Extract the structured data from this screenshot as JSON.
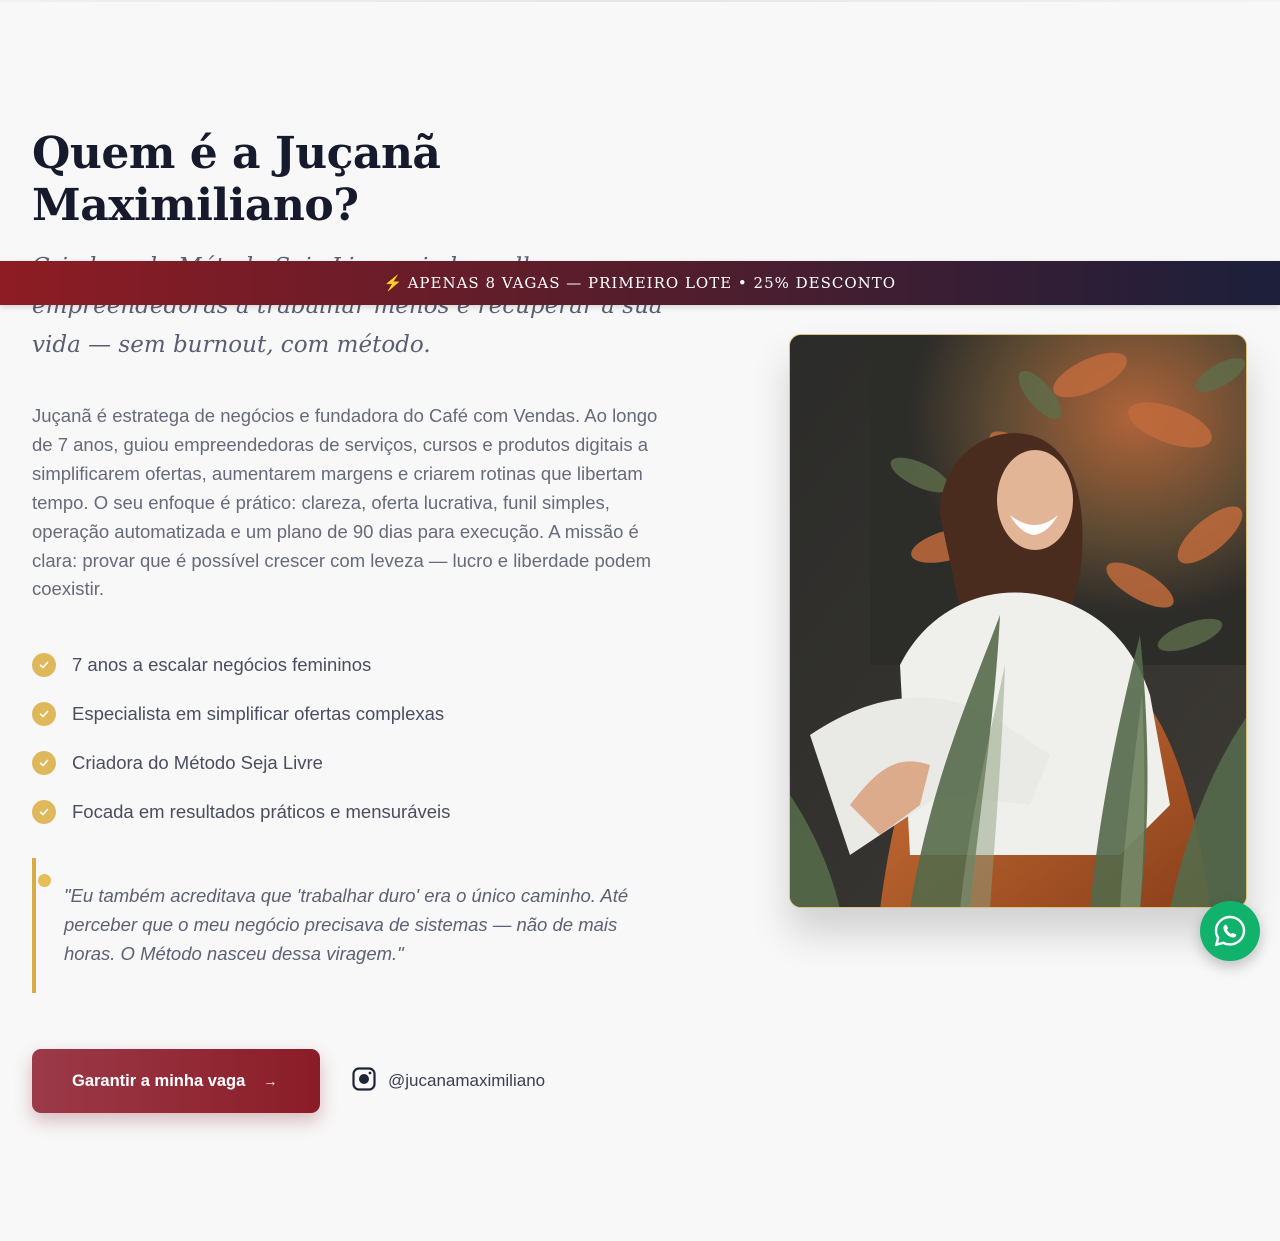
{
  "section": {
    "title": "Quem é a Juçanã Maximiliano?",
    "subtitle": "Criadora do Método Seja Livre, ajudo mulheres empreendedoras a trabalhar menos e recuperar a sua vida — sem burnout, com método.",
    "bio": "Juçanã é estratega de negócios e fundadora do Café com Vendas. Ao longo de 7 anos, guiou empreendedoras de serviços, cursos e produtos digitais a simplificarem ofertas, aumentarem margens e criarem rotinas que libertam tempo. O seu enfoque é prático: clareza, oferta lucrativa, funil simples, operação automatizada e um plano de 90 dias para execução. A missão é clara: provar que é possível crescer com leveza — lucro e liberdade podem coexistir.",
    "credentials": [
      "7 anos a escalar negócios femininos",
      "Especialista em simplificar ofertas complexas",
      "Criadora do Método Seja Livre",
      "Focada em resultados práticos e mensuráveis"
    ],
    "quote": "\"Eu também acreditava que 'trabalhar duro' era o único caminho. Até perceber que o meu negócio precisava de sistemas — não de mais horas. O Método nasceu dessa viragem.\"",
    "cta_label": "Garantir a minha vaga",
    "cta_arrow": "→",
    "instagram_handle": "@jucanamaximiliano"
  },
  "banner": {
    "bolt": "⚡",
    "text": "APENAS 8 VAGAS — PRIMEIRO LOTE • 25% DESCONTO"
  },
  "icons": {
    "check": "check-circle-icon",
    "instagram": "instagram-icon",
    "whatsapp": "whatsapp-icon"
  },
  "colors": {
    "accent_gold": "#dfb85c",
    "cta_red": "#8a1c26",
    "banner_navy": "#1c1f3b",
    "whatsapp_green": "#11b26b"
  }
}
